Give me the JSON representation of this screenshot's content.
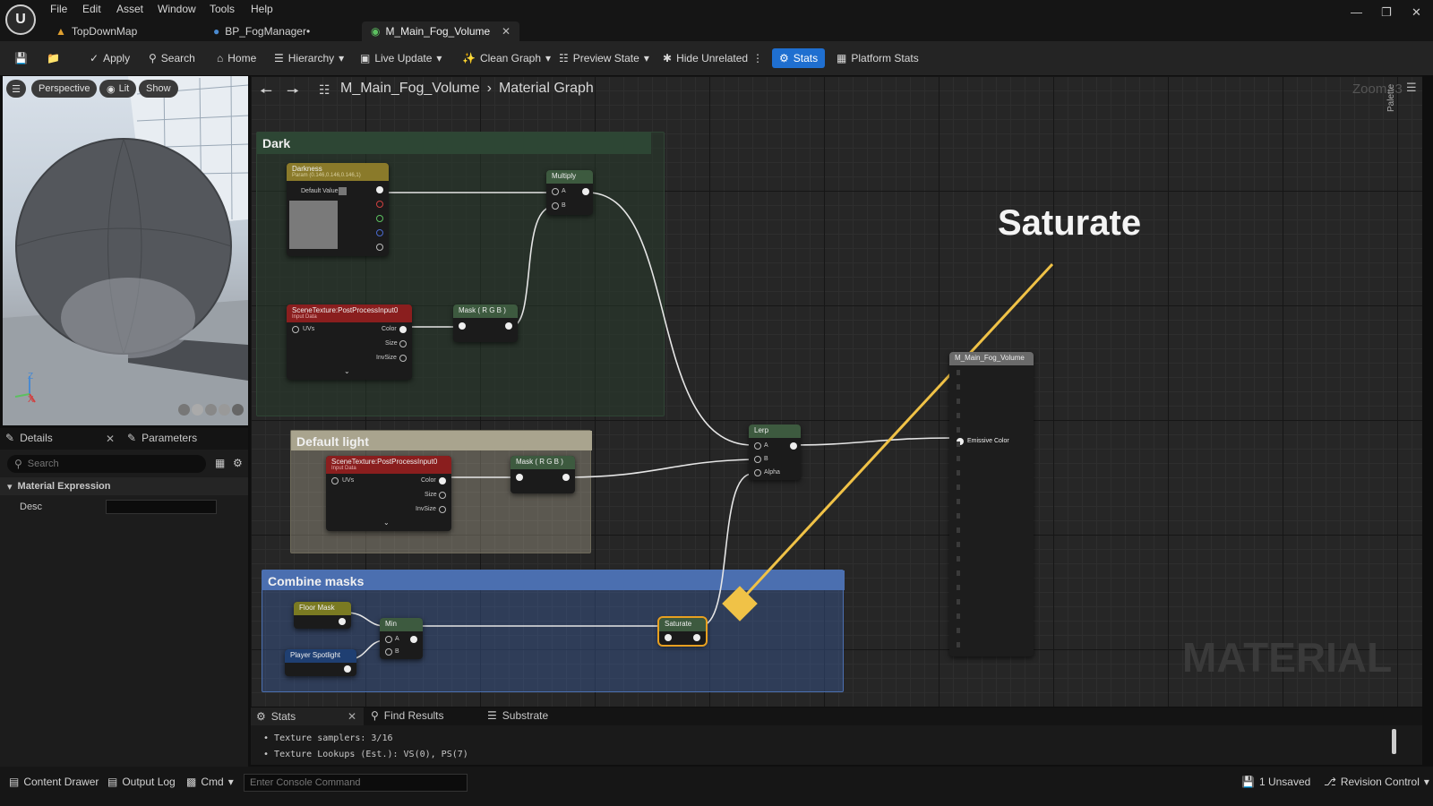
{
  "menu": [
    "File",
    "Edit",
    "Asset",
    "Window",
    "Tools",
    "Help"
  ],
  "tabs": [
    {
      "label": "TopDownMap"
    },
    {
      "label": "BP_FogManager•"
    },
    {
      "label": "M_Main_Fog_Volume"
    }
  ],
  "toolbar": {
    "apply": "Apply",
    "search": "Search",
    "home": "Home",
    "hierarchy": "Hierarchy",
    "live_update": "Live Update",
    "clean_graph": "Clean Graph",
    "preview_state": "Preview State",
    "hide_unrelated": "Hide Unrelated",
    "stats": "Stats",
    "platform_stats": "Platform Stats"
  },
  "viewport": {
    "perspective": "Perspective",
    "lit": "Lit",
    "show": "Show",
    "axis_z": "Z",
    "axis_x": "X"
  },
  "details": {
    "tab_details": "Details",
    "tab_parameters": "Parameters",
    "search_placeholder": "Search",
    "section": "Material Expression",
    "desc_label": "Desc"
  },
  "graph": {
    "breadcrumb_material": "M_Main_Fog_Volume",
    "breadcrumb_graph": "Material Graph",
    "zoom": "Zoom -3",
    "palette": "Palette",
    "watermark": "MATERIAL",
    "annotation": "Saturate",
    "comments": {
      "dark": "Dark",
      "default_light": "Default light",
      "combine": "Combine masks"
    },
    "nodes": {
      "darkness": {
        "title": "Darkness",
        "subtitle": "Param (0.146,0.146,0.146,1)",
        "default_value": "Default Value"
      },
      "multiply": {
        "title": "Multiply",
        "a": "A",
        "b": "B"
      },
      "scene1": {
        "title": "SceneTexture:PostProcessInput0",
        "subtitle": "Input Data",
        "uvs": "UVs",
        "color": "Color",
        "size": "Size",
        "invsize": "InvSize"
      },
      "scene2": {
        "title": "SceneTexture:PostProcessInput0",
        "subtitle": "Input Data",
        "uvs": "UVs",
        "color": "Color",
        "size": "Size",
        "invsize": "InvSize"
      },
      "mask1": {
        "title": "Mask ( R G B )"
      },
      "mask2": {
        "title": "Mask ( R G B )"
      },
      "lerp": {
        "title": "Lerp",
        "a": "A",
        "b": "B",
        "alpha": "Alpha"
      },
      "floor_mask": {
        "title": "Floor Mask"
      },
      "player_spotlight": {
        "title": "Player Spotlight"
      },
      "min": {
        "title": "Min",
        "a": "A",
        "b": "B"
      },
      "saturate": {
        "title": "Saturate"
      },
      "result": {
        "title": "M_Main_Fog_Volume",
        "emissive": "Emissive Color"
      }
    }
  },
  "stats_panel": {
    "tab_stats": "Stats",
    "tab_find": "Find Results",
    "tab_substrate": "Substrate",
    "lines": [
      "Texture samplers: 3/16",
      "Texture Lookups (Est.): VS(0), PS(7)"
    ]
  },
  "bottom": {
    "content_drawer": "Content Drawer",
    "output_log": "Output Log",
    "cmd": "Cmd",
    "console_placeholder": "Enter Console Command",
    "unsaved": "1 Unsaved",
    "revision": "Revision Control"
  },
  "colors": {
    "accent": "#1f6fd0",
    "highlight": "#f0c247",
    "combine": "#4b6fb0",
    "default_light": "#bfb8a0",
    "dark": "#2b3a2e"
  }
}
